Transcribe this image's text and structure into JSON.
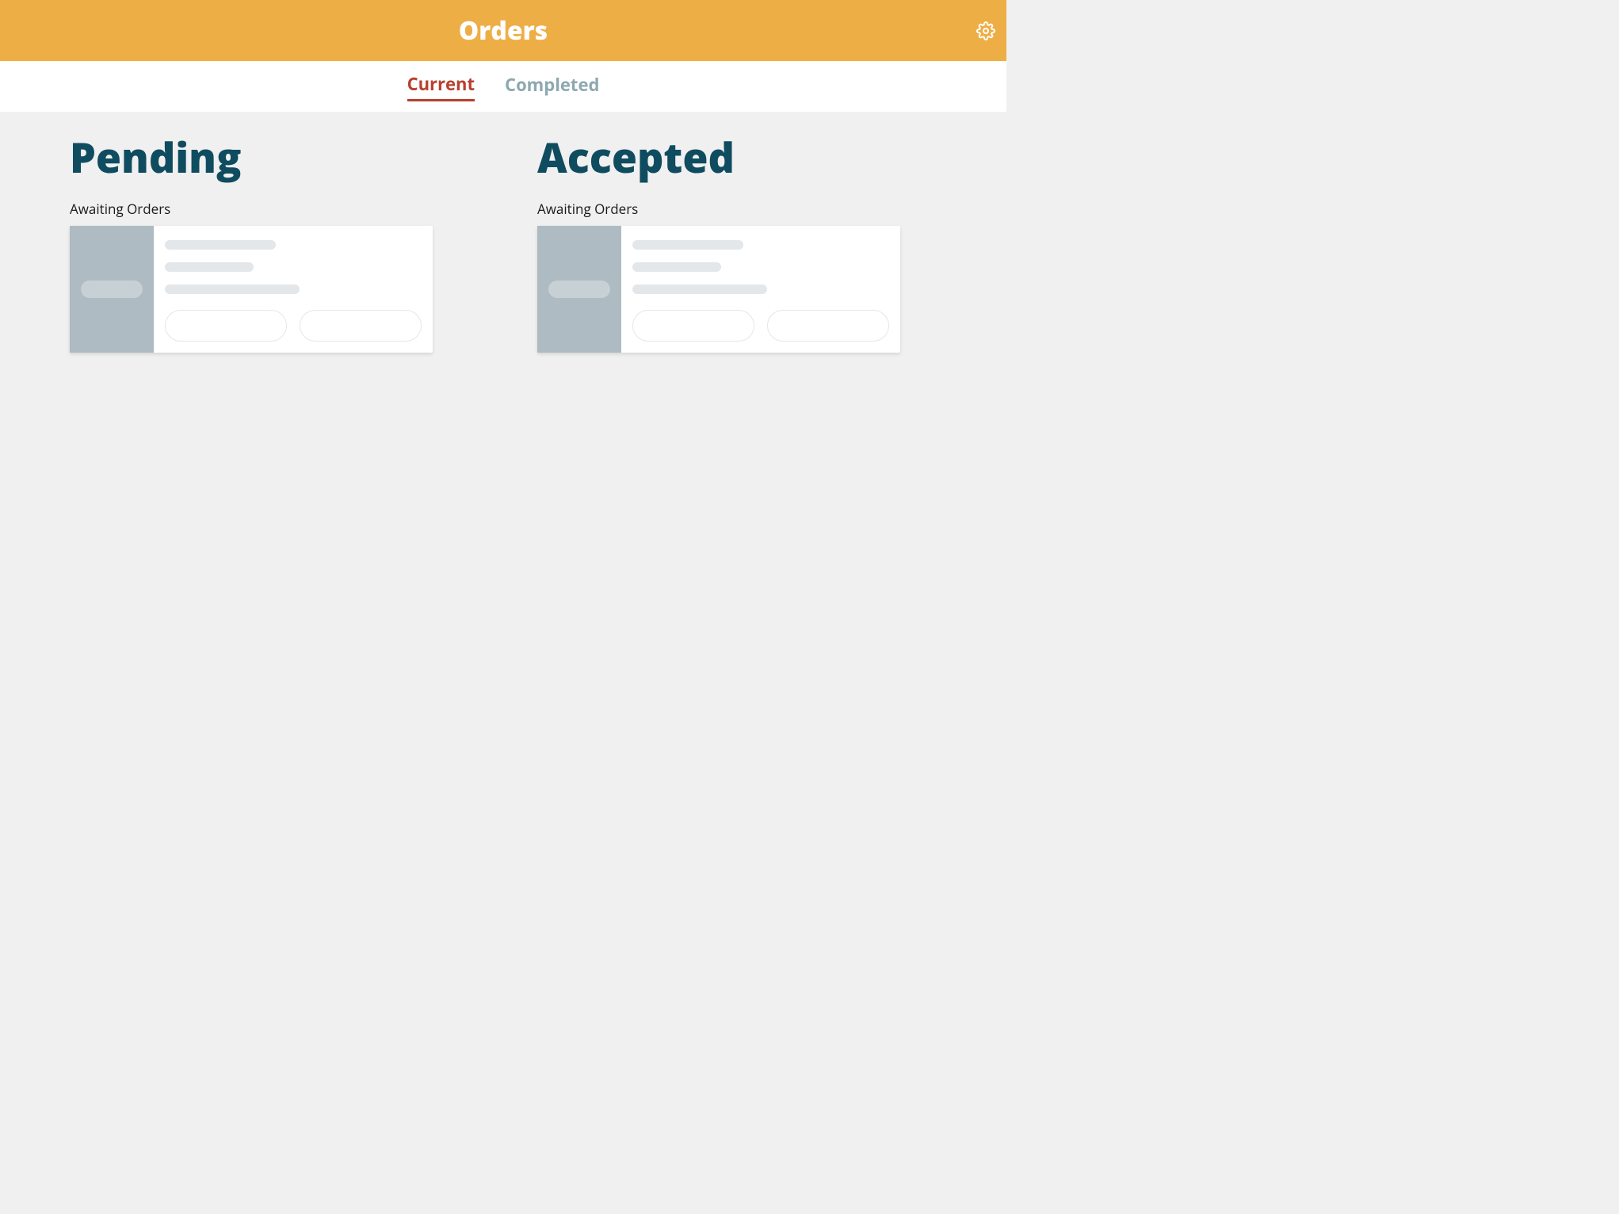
{
  "header": {
    "title": "Orders",
    "settings_icon": "gear-icon"
  },
  "tabs": {
    "current": "Current",
    "completed": "Completed",
    "active": "current"
  },
  "columns": {
    "pending": {
      "title": "Pending",
      "subtitle": "Awaiting Orders"
    },
    "accepted": {
      "title": "Accepted",
      "subtitle": "Awaiting Orders"
    }
  }
}
